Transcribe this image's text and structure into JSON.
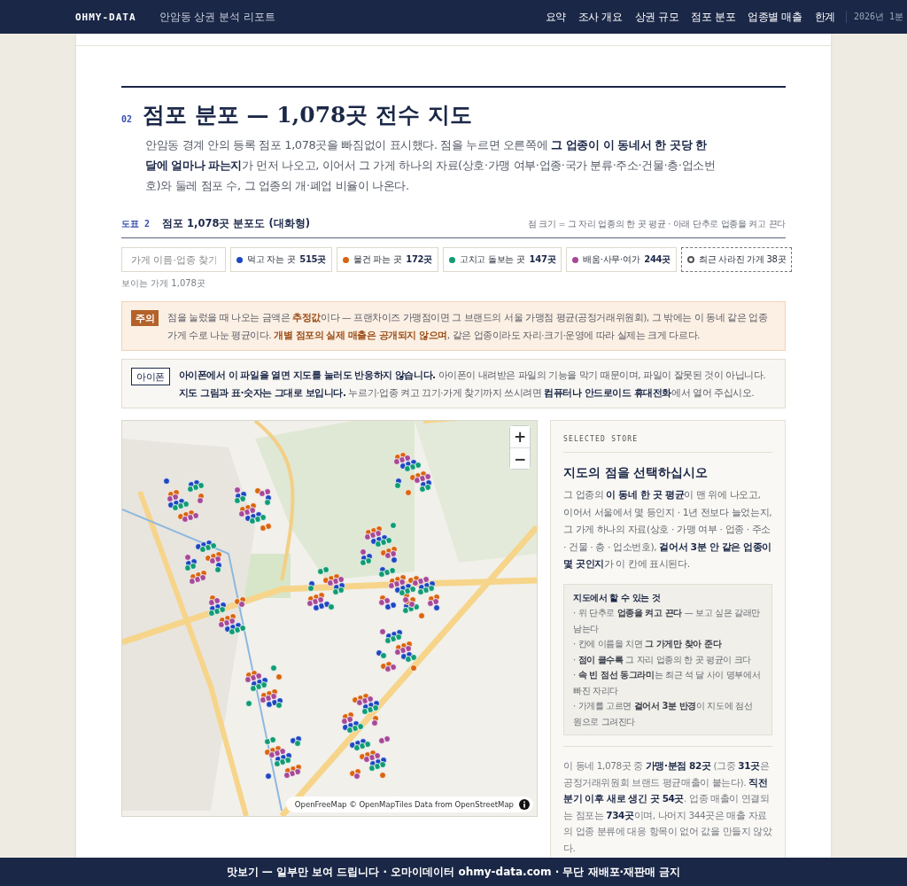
{
  "header": {
    "brand": "OHMY-DATA",
    "subtitle": "안암동 상권 분석 리포트",
    "nav": [
      {
        "label": "요약"
      },
      {
        "label": "조사 개요"
      },
      {
        "label": "상권 규모"
      },
      {
        "label": "점포 분포"
      },
      {
        "label": "업종별 매출"
      },
      {
        "label": "한계"
      }
    ],
    "period": "2026년 1분"
  },
  "section": {
    "number": "02",
    "title": "점포 분포 — 1,078곳 전수 지도",
    "lead": "안암동 경계 안의 등록 점포 1,078곳을 빠짐없이 표시했다. 점을 누르면 오른쪽에 **그 업종이 이 동네서 한 곳당 한 달에 얼마나 파는지**가 먼저 나오고, 이어서 그 가게 하나의 자료(상호·가맹 여부·업종·국가 분류·주소·건물·층·업소번호)와 둘레 점포 수, 그 업종의 개·폐업 비율이 나온다."
  },
  "figure": {
    "label": "도표 2",
    "title": "점포 1,078곳 분포도 (대화형)",
    "note": "점 크기 = 그 자리 업종의 한 곳 평균 · 아래 단추로 업종을 켜고 끈다"
  },
  "search": {
    "placeholder": "가게 이름·업종 찾기"
  },
  "filters": [
    {
      "kind": "category",
      "label": "먹고 자는 곳",
      "count": "515곳",
      "color": "#1f47c2"
    },
    {
      "kind": "category",
      "label": "물건 파는 곳",
      "count": "172곳",
      "color": "#d9650f"
    },
    {
      "kind": "category",
      "label": "고치고 돌보는 곳",
      "count": "147곳",
      "color": "#129c74"
    },
    {
      "kind": "category",
      "label": "배움·사무·여가",
      "count": "244곳",
      "color": "#a64a98"
    },
    {
      "kind": "closed",
      "label": "최근 사라진 가게",
      "count": "38곳",
      "color": "#555555"
    }
  ],
  "visible_count": "보이는 가게 1,078곳",
  "notices": [
    {
      "kind": "caution",
      "badge": "주의",
      "text": "점을 눌렀을 때 나오는 금액은 **추정값**이다 — 프랜차이즈 가맹점이면 그 브랜드의 서울 가맹점 평균(공정거래위원회), 그 밖에는 이 동네 같은 업종 가게 수로 나눈 평균이다. **개별 점포의 실제 매출은 공개되지 않으며**, 같은 업종이라도 자리·크기·운영에 따라 실제는 크게 다르다."
    },
    {
      "kind": "device",
      "badge": "아이폰",
      "text": "**아이폰에서 이 파일을 열면 지도를 눌러도 반응하지 않습니다.** 아이폰이 내려받은 파일의 기능을 막기 때문이며, 파일이 잘못된 것이 아닙니다. **지도 그림과 표·숫자는 그대로 보입니다.** 누르기·업종 켜고 끄기·가게 찾기까지 쓰시려면 **컴퓨터나 안드로이드 휴대전화**에서 열어 주십시오."
    }
  ],
  "map": {
    "kind": "picture",
    "zoom_in": "+",
    "zoom_out": "−",
    "attribution": "OpenFreeMap © OpenMapTiles Data from OpenStreetMap"
  },
  "panel": {
    "eyebrow": "SELECTED STORE",
    "title": "지도의 점을 선택하십시오",
    "body": "그 업종의 **이 동네 한 곳 평균**이 맨 위에 나오고, 이어서 서울에서 몇 등인지 · 1년 전보다 늘었는지, 그 가게 하나의 자료(상호 · 가맹 여부 · 업종 · 주소 · 건물 · 층 · 업소번호), **걸어서 3분 안 같은 업종이 몇 곳인지**가 이 칸에 표시된다.",
    "tips": {
      "title": "지도에서 할 수 있는 것",
      "items": [
        "· 위 단추로 **업종을 켜고 끈다** — 보고 싶은 갈래만 남는다",
        "· 칸에 이름을 치면 **그 가게만 찾아 준다**",
        "· **점이 클수록** 그 자리 업종의 한 곳 평균이 크다",
        "· **속 빈 점선 동그라미**는 최근 석 달 사이 명부에서 빠진 자리다",
        "· 가게를 고르면 **걸어서 3분 반경**이 지도에 점선 원으로 그려진다"
      ]
    },
    "summary": "이 동네 1,078곳 중 **가맹·분점 82곳** (그중 **31곳**은 공정거래위원회 브랜드 평균매출이 붙는다). **직전 분기 이후 새로 생긴 곳 54곳**. 업종 매출이 연결되는 점포는 **734곳**이며, 나머지 344곳은 매출 자료의 업종 분류에 대응 항목이 없어 값을 만들지 않았다."
  },
  "footer": "맛보기 — 일부만 보여 드립니다 · 오마이데이터 ohmy-data.com · 무단 재배포·재판매 금지"
}
